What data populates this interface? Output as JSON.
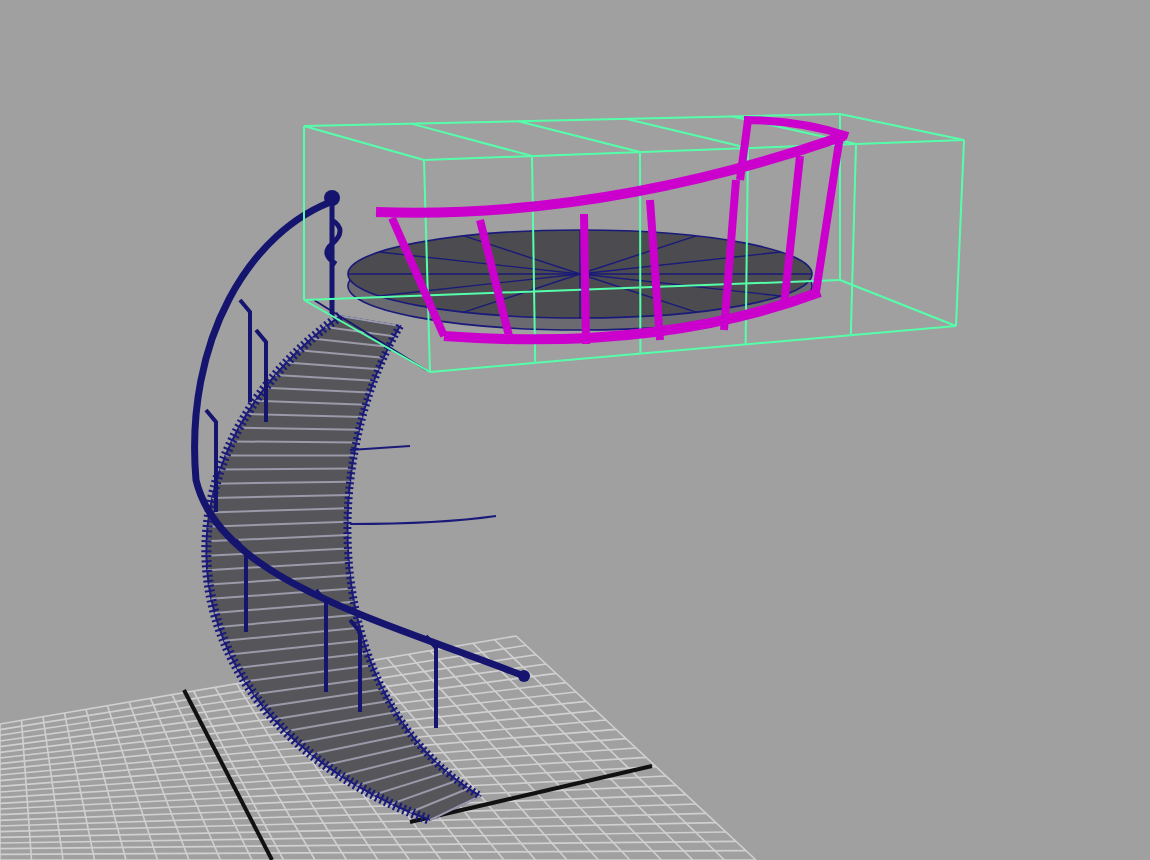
{
  "viewport": {
    "objects": [
      {
        "kind": "grid",
        "selected": false
      },
      {
        "kind": "staircase",
        "selected": false
      },
      {
        "kind": "handrail",
        "selected": false
      },
      {
        "kind": "landing",
        "selected": false
      },
      {
        "kind": "railing",
        "selected": true
      }
    ]
  }
}
